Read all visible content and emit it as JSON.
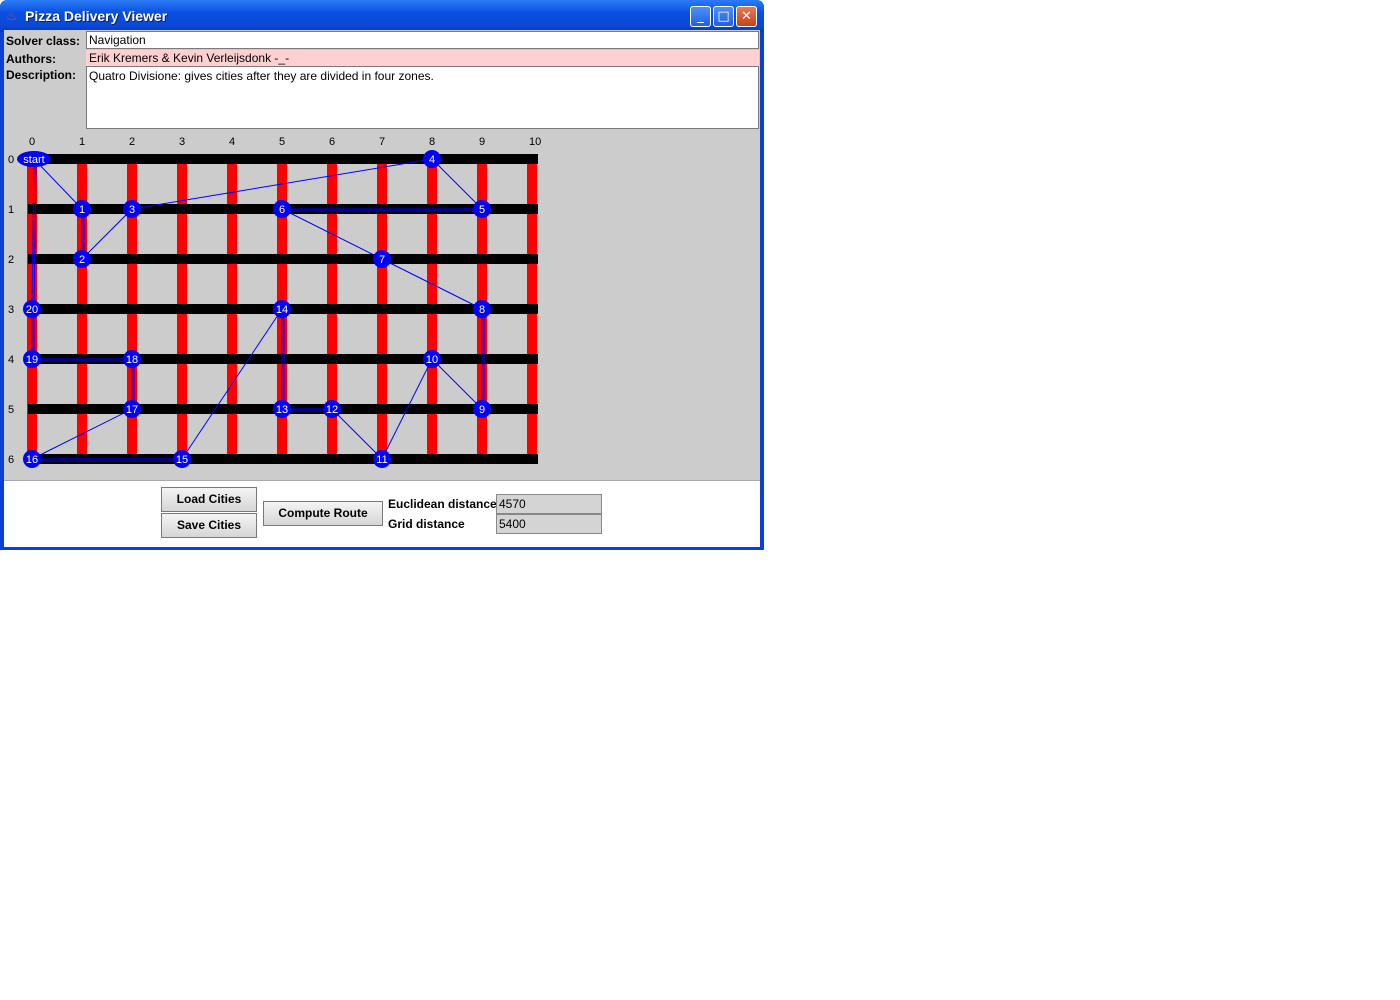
{
  "window": {
    "title": "Pizza Delivery Viewer",
    "minimize_glyph": "_",
    "maximize_glyph": "□",
    "close_glyph": "✕"
  },
  "form": {
    "solver_label": "Solver class:",
    "solver_value": "Navigation",
    "authors_label": "Authors:",
    "authors_value": "Erik Kremers & Kevin Verleijsdonk -_-",
    "description_label": "Description:",
    "description_value": "Quatro Divisione: gives cities after they are divided in four zones."
  },
  "grid": {
    "columns": [
      "0",
      "1",
      "2",
      "3",
      "4",
      "5",
      "6",
      "7",
      "8",
      "9",
      "10"
    ],
    "rows": [
      "0",
      "1",
      "2",
      "3",
      "4",
      "5",
      "6"
    ],
    "colors": {
      "road_h": "#000000",
      "road_v": "#ff0000",
      "city": "#0000ff",
      "route": "#0000ff"
    },
    "cities": [
      {
        "label": "start",
        "col": 0,
        "row": 0
      },
      {
        "label": "1",
        "col": 1,
        "row": 1
      },
      {
        "label": "2",
        "col": 1,
        "row": 2
      },
      {
        "label": "3",
        "col": 2,
        "row": 1
      },
      {
        "label": "4",
        "col": 8,
        "row": 0
      },
      {
        "label": "5",
        "col": 9,
        "row": 1
      },
      {
        "label": "6",
        "col": 5,
        "row": 1
      },
      {
        "label": "7",
        "col": 7,
        "row": 2
      },
      {
        "label": "8",
        "col": 9,
        "row": 3
      },
      {
        "label": "9",
        "col": 9,
        "row": 5
      },
      {
        "label": "10",
        "col": 8,
        "row": 4
      },
      {
        "label": "11",
        "col": 7,
        "row": 6
      },
      {
        "label": "12",
        "col": 6,
        "row": 5
      },
      {
        "label": "13",
        "col": 5,
        "row": 5
      },
      {
        "label": "14",
        "col": 5,
        "row": 3
      },
      {
        "label": "15",
        "col": 3,
        "row": 6
      },
      {
        "label": "16",
        "col": 0,
        "row": 6
      },
      {
        "label": "17",
        "col": 2,
        "row": 5
      },
      {
        "label": "18",
        "col": 2,
        "row": 4
      },
      {
        "label": "19",
        "col": 0,
        "row": 4
      },
      {
        "label": "20",
        "col": 0,
        "row": 3
      }
    ],
    "route": [
      "start",
      "1",
      "2",
      "3",
      "4",
      "5",
      "6",
      "7",
      "8",
      "9",
      "10",
      "11",
      "12",
      "13",
      "14",
      "15",
      "16",
      "17",
      "18",
      "19",
      "20",
      "start"
    ]
  },
  "controls": {
    "load_label": "Load Cities",
    "save_label": "Save Cities",
    "compute_label": "Compute Route",
    "euclid_label": "Euclidean distance",
    "euclid_value": "4570",
    "grid_label": "Grid distance",
    "grid_value": "5400"
  }
}
